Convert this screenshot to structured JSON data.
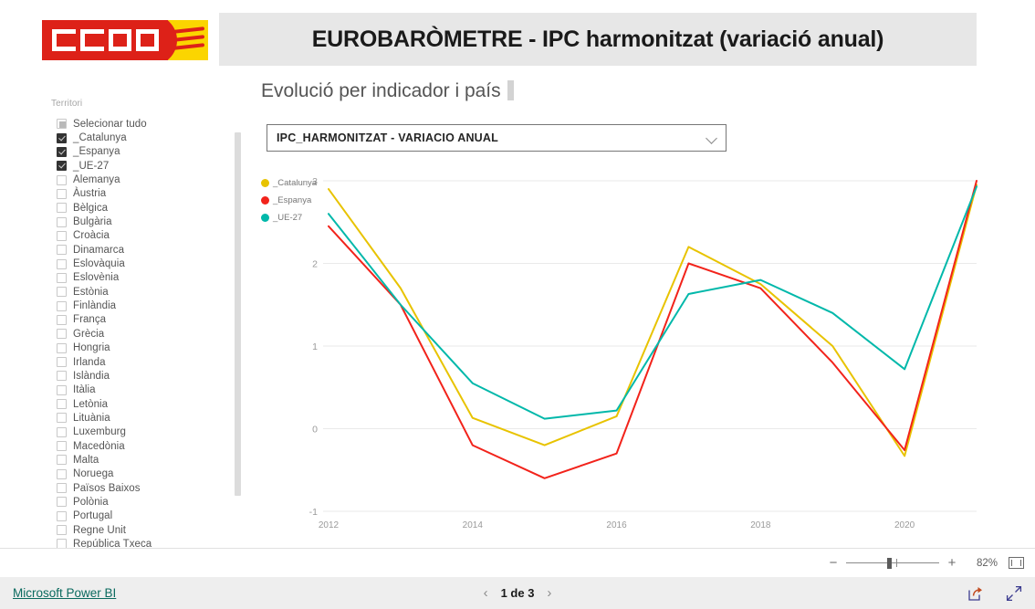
{
  "header": {
    "title": "EUROBARÒMETRE - IPC harmonitzat (variació anual)",
    "logo_text": "CCOO",
    "logo_colors": {
      "red": "#dd2118",
      "yellow": "#fbd500",
      "white": "#ffffff"
    }
  },
  "slicer": {
    "title": "Territori",
    "items": [
      {
        "label": "Selecionar tudo",
        "state": "partial"
      },
      {
        "label": "_Catalunya",
        "state": "checked"
      },
      {
        "label": "_Espanya",
        "state": "checked"
      },
      {
        "label": "_UE-27",
        "state": "checked"
      },
      {
        "label": "Alemanya",
        "state": "unchecked"
      },
      {
        "label": "Àustria",
        "state": "unchecked"
      },
      {
        "label": "Bèlgica",
        "state": "unchecked"
      },
      {
        "label": "Bulgària",
        "state": "unchecked"
      },
      {
        "label": "Croàcia",
        "state": "unchecked"
      },
      {
        "label": "Dinamarca",
        "state": "unchecked"
      },
      {
        "label": "Eslovàquia",
        "state": "unchecked"
      },
      {
        "label": "Eslovènia",
        "state": "unchecked"
      },
      {
        "label": "Estònia",
        "state": "unchecked"
      },
      {
        "label": "Finlàndia",
        "state": "unchecked"
      },
      {
        "label": "França",
        "state": "unchecked"
      },
      {
        "label": "Grècia",
        "state": "unchecked"
      },
      {
        "label": "Hongria",
        "state": "unchecked"
      },
      {
        "label": "Irlanda",
        "state": "unchecked"
      },
      {
        "label": "Islàndia",
        "state": "unchecked"
      },
      {
        "label": "Itàlia",
        "state": "unchecked"
      },
      {
        "label": "Letònia",
        "state": "unchecked"
      },
      {
        "label": "Lituània",
        "state": "unchecked"
      },
      {
        "label": "Luxemburg",
        "state": "unchecked"
      },
      {
        "label": "Macedònia",
        "state": "unchecked"
      },
      {
        "label": "Malta",
        "state": "unchecked"
      },
      {
        "label": "Noruega",
        "state": "unchecked"
      },
      {
        "label": "Països Baixos",
        "state": "unchecked"
      },
      {
        "label": "Polònia",
        "state": "unchecked"
      },
      {
        "label": "Portugal",
        "state": "unchecked"
      },
      {
        "label": "Regne Unit",
        "state": "unchecked"
      },
      {
        "label": "República Txeca",
        "state": "unchecked"
      }
    ]
  },
  "visual": {
    "title": "Evolució per indicador i país",
    "dropdown_value": "IPC_HARMONITZAT - VARIACIO ANUAL"
  },
  "chart_data": {
    "type": "line",
    "title": "",
    "xlabel": "",
    "ylabel": "",
    "x": [
      2012,
      2013,
      2014,
      2015,
      2016,
      2017,
      2018,
      2019,
      2020,
      2021
    ],
    "tick_labels_x": [
      "2012",
      "2014",
      "2016",
      "2018",
      "2020"
    ],
    "tick_labels_y": [
      "3",
      "2",
      "1",
      "0",
      "-1"
    ],
    "xlim": [
      2012,
      2021
    ],
    "ylim": [
      -1,
      3
    ],
    "grid": true,
    "legend_position": "top-left",
    "series": [
      {
        "name": "_Catalunya",
        "color": "#e8c300",
        "values": [
          2.9,
          1.7,
          0.13,
          -0.2,
          0.15,
          2.2,
          1.75,
          1.0,
          -0.33,
          2.95
        ]
      },
      {
        "name": "_Espanya",
        "color": "#f2231b",
        "values": [
          2.45,
          1.5,
          -0.2,
          -0.6,
          -0.3,
          2.0,
          1.7,
          0.8,
          -0.26,
          3.0
        ]
      },
      {
        "name": "_UE-27",
        "color": "#01b8aa",
        "values": [
          2.6,
          1.5,
          0.55,
          0.12,
          0.22,
          1.63,
          1.8,
          1.4,
          0.72,
          2.93
        ]
      }
    ]
  },
  "zoom_bar": {
    "minus_label": "−",
    "plus_label": "+",
    "percent": "82%"
  },
  "footer": {
    "brand": "Microsoft Power BI",
    "prev_arrow": "‹",
    "next_arrow": "›",
    "page_text": "1 de 3"
  }
}
